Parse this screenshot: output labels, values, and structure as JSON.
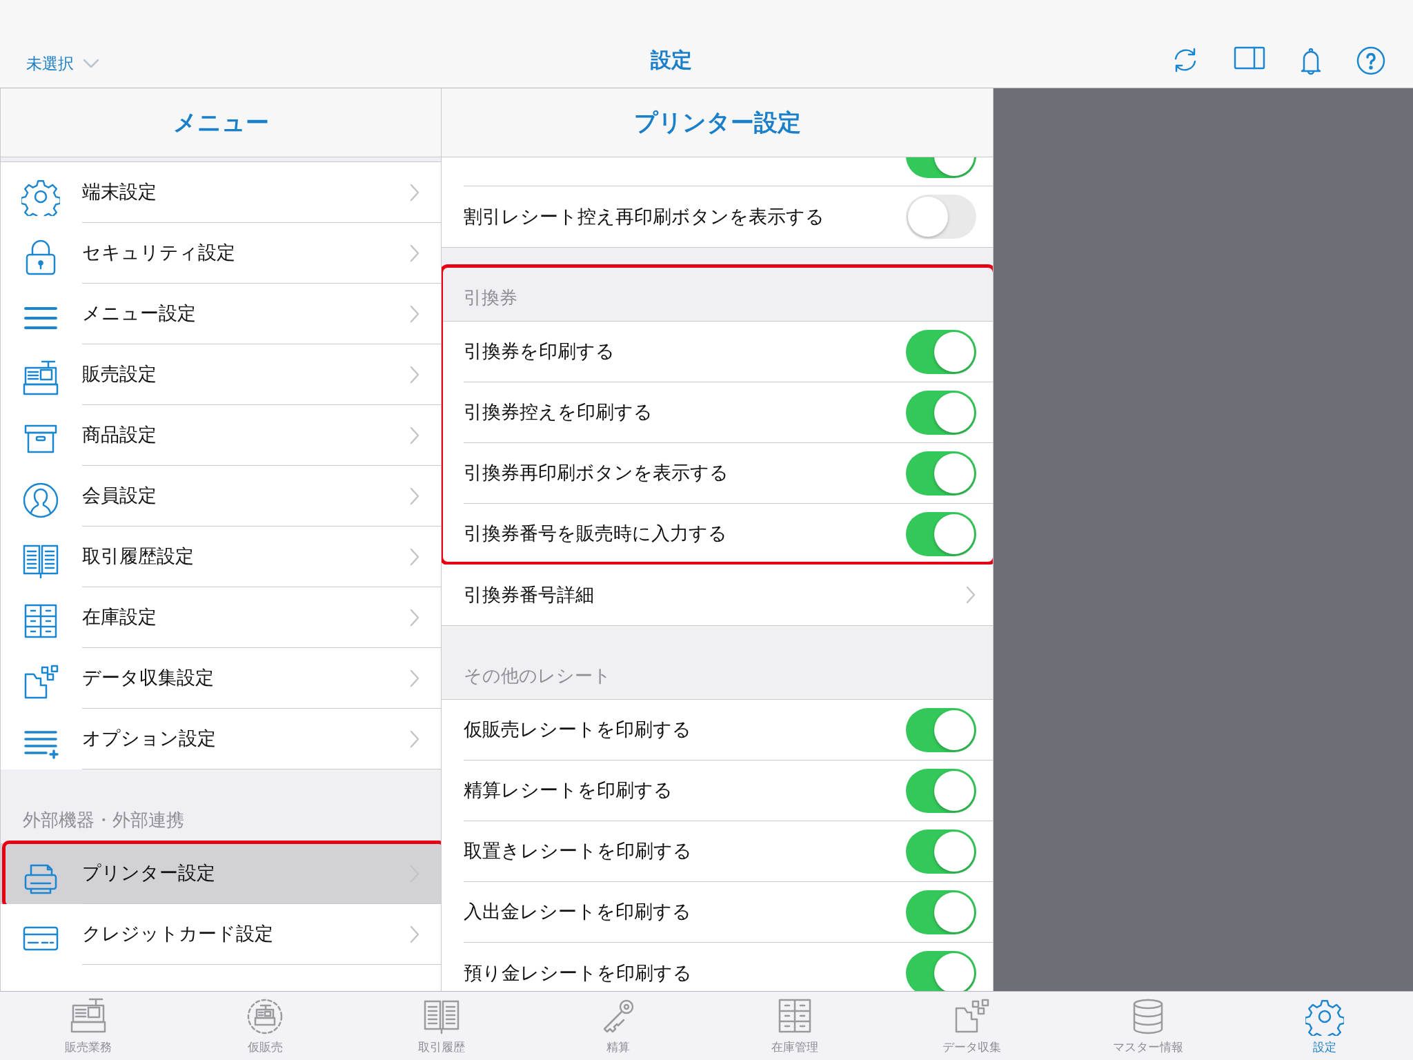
{
  "top_bar": {
    "selector": "未選択",
    "title": "設定"
  },
  "menu": {
    "title": "メニュー",
    "groups": [
      {
        "items": [
          {
            "label": "端末設定",
            "selected": false,
            "highlighted": false
          },
          {
            "label": "セキュリティ設定",
            "selected": false,
            "highlighted": false
          },
          {
            "label": "メニュー設定",
            "selected": false,
            "highlighted": false
          },
          {
            "label": "販売設定",
            "selected": false,
            "highlighted": false
          },
          {
            "label": "商品設定",
            "selected": false,
            "highlighted": false
          },
          {
            "label": "会員設定",
            "selected": false,
            "highlighted": false
          },
          {
            "label": "取引履歴設定",
            "selected": false,
            "highlighted": false
          },
          {
            "label": "在庫設定",
            "selected": false,
            "highlighted": false
          },
          {
            "label": "データ収集設定",
            "selected": false,
            "highlighted": false
          },
          {
            "label": "オプション設定",
            "selected": false,
            "highlighted": false
          }
        ]
      },
      {
        "header": "外部機器・外部連携",
        "items": [
          {
            "label": "プリンター設定",
            "selected": true,
            "highlighted": true
          },
          {
            "label": "クレジットカード設定",
            "selected": false,
            "highlighted": false
          }
        ]
      }
    ]
  },
  "detail": {
    "title": "プリンター設定",
    "groups": [
      {
        "highlighted": false,
        "items": [
          {
            "kind": "toggle",
            "on": true
          },
          {
            "kind": "toggle",
            "label": "割引レシート控え再印刷ボタンを表示する",
            "on": false
          }
        ]
      },
      {
        "header": "引換券",
        "highlighted": true,
        "items": [
          {
            "kind": "toggle",
            "label": "引換券を印刷する",
            "on": true
          },
          {
            "kind": "toggle",
            "label": "引換券控えを印刷する",
            "on": true
          },
          {
            "kind": "toggle",
            "label": "引換券再印刷ボタンを表示する",
            "on": true
          },
          {
            "kind": "toggle",
            "label": "引換券番号を販売時に入力する",
            "on": true
          }
        ]
      },
      {
        "highlighted": false,
        "items": [
          {
            "kind": "link",
            "label": "引換券番号詳細"
          }
        ]
      },
      {
        "header": "その他のレシート",
        "highlighted": false,
        "items": [
          {
            "kind": "toggle",
            "label": "仮販売レシートを印刷する",
            "on": true
          },
          {
            "kind": "toggle",
            "label": "精算レシートを印刷する",
            "on": true
          },
          {
            "kind": "toggle",
            "label": "取置きレシートを印刷する",
            "on": true
          },
          {
            "kind": "toggle",
            "label": "入出金レシートを印刷する",
            "on": true
          },
          {
            "kind": "toggle",
            "label": "預り金レシートを印刷する",
            "on": true
          }
        ]
      }
    ]
  },
  "tab_bar": [
    {
      "label": "販売業務",
      "selected": false
    },
    {
      "label": "仮販売",
      "selected": false
    },
    {
      "label": "取引履歴",
      "selected": false
    },
    {
      "label": "精算",
      "selected": false
    },
    {
      "label": "在庫管理",
      "selected": false
    },
    {
      "label": "データ収集",
      "selected": false
    },
    {
      "label": "マスター情報",
      "selected": false
    },
    {
      "label": "設定",
      "selected": true
    }
  ]
}
